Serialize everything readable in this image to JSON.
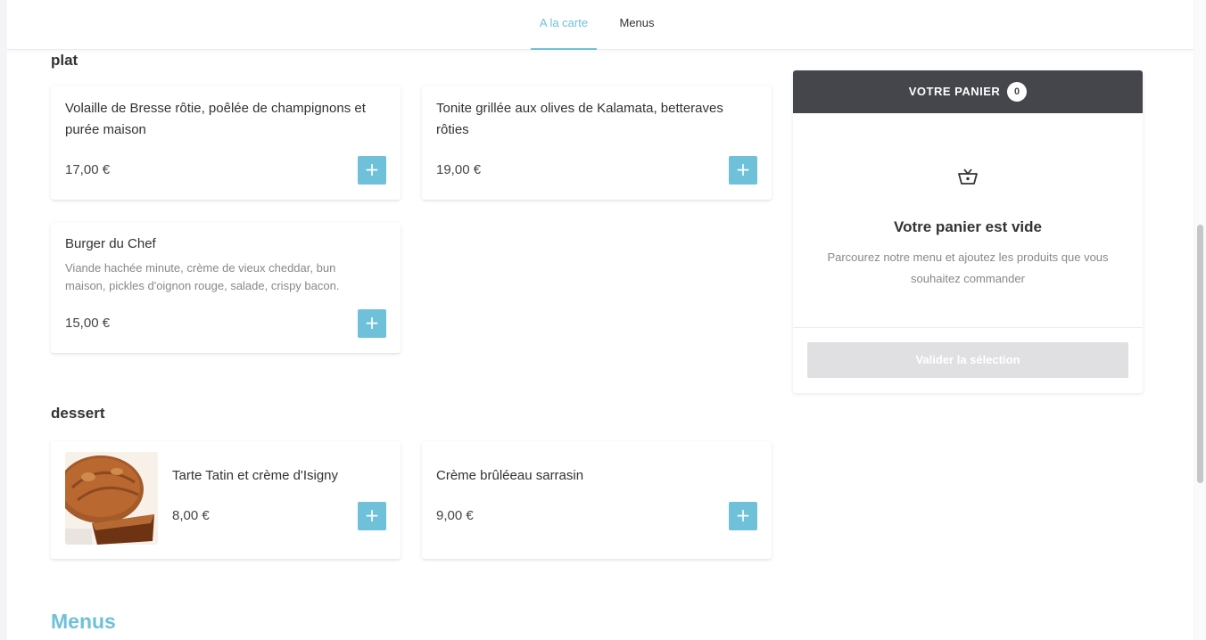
{
  "tabs": [
    {
      "label": "A la carte",
      "active": true
    },
    {
      "label": "Menus",
      "active": false
    }
  ],
  "sections": {
    "plat": {
      "title": "plat",
      "items": [
        {
          "name": "Volaille de Bresse rôtie, poêlée de champignons et purée maison",
          "price": "17,00 €"
        },
        {
          "name": "Tonite grillée aux olives de Kalamata, betteraves rôties",
          "price": "19,00 €"
        },
        {
          "name": "Burger du Chef",
          "description": "Viande hachée minute, crème de vieux cheddar, bun maison, pickles d'oignon rouge, salade, crispy bacon.",
          "price": "15,00 €"
        }
      ]
    },
    "dessert": {
      "title": "dessert",
      "items": [
        {
          "name": "Tarte Tatin et crème d'Isigny",
          "price": "8,00 €",
          "image": "tarte-tatin-photo"
        },
        {
          "name": "Crème brûléeau sarrasin",
          "price": "9,00 €"
        }
      ]
    },
    "menus_heading": "Menus"
  },
  "add_button_label": "+",
  "cart": {
    "title": "VOTRE PANIER",
    "count": "0",
    "icon": "basket-icon",
    "empty_title": "Votre panier est vide",
    "empty_text": "Parcourez notre menu et ajoutez les produits que vous souhaitez commander",
    "validate_label": "Valider la sélection"
  },
  "colors": {
    "accent": "#6ec1d8",
    "cart_header": "#44464b",
    "disabled_button": "#e0e0e2"
  }
}
